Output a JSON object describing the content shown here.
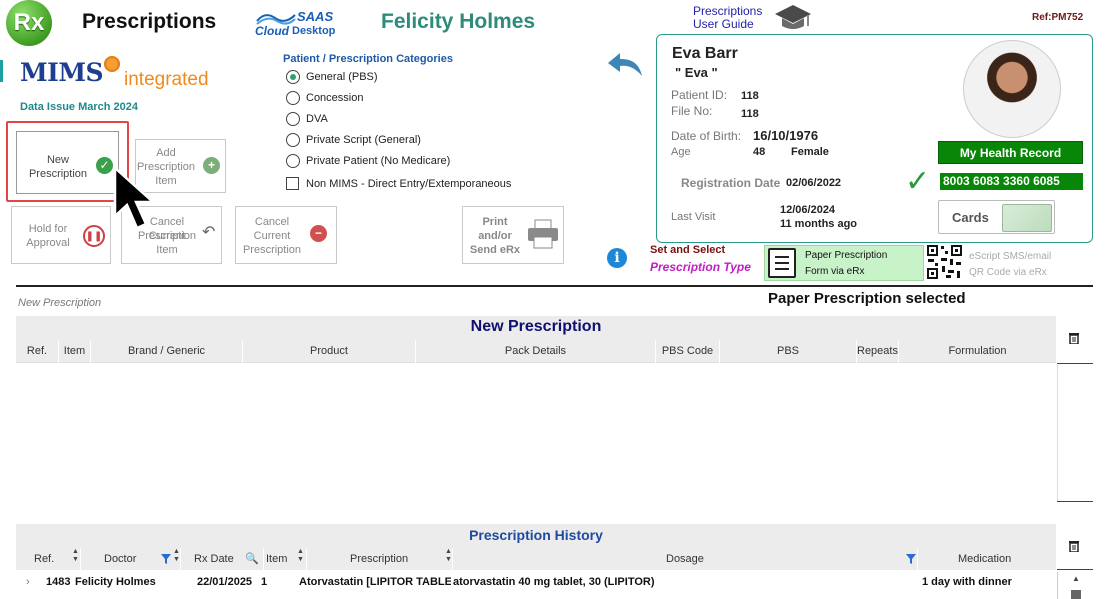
{
  "header": {
    "rx_logo": "Rx",
    "app_title": "Prescriptions",
    "saas_line1": "SAAS",
    "saas_line2": "Cloud",
    "saas_line3": "Desktop",
    "doctor_name": "Felicity Holmes",
    "user_guide_line1": "Prescriptions",
    "user_guide_line2": "User Guide",
    "ref_code": "Ref:PM752"
  },
  "mims": {
    "logo_text": "MIMS",
    "logo_suffix": "integrated",
    "data_issue": "Data Issue   March 2024"
  },
  "categories": {
    "title": "Patient / Prescription Categories",
    "options": [
      {
        "label": "General (PBS)",
        "selected": true
      },
      {
        "label": "Concession",
        "selected": false
      },
      {
        "label": "DVA",
        "selected": false
      },
      {
        "label": "Private Script (General)",
        "selected": false
      },
      {
        "label": "Private Patient (No Medicare)",
        "selected": false
      }
    ],
    "non_mims_label": "Non MIMS - Direct Entry/Extemporaneous"
  },
  "actions": {
    "new_rx": [
      "New",
      "Prescription"
    ],
    "add_item": [
      "Add",
      "Prescription",
      "Item"
    ],
    "hold": [
      "Hold for",
      "Approval"
    ],
    "cancel_item": [
      "Cancel Current",
      "Prescription",
      "Item"
    ],
    "cancel_rx": [
      "Cancel",
      "Current",
      "Prescription"
    ],
    "print": [
      "Print",
      "and/or",
      "Send eRx"
    ]
  },
  "patient": {
    "name": "Eva Barr",
    "preferred": "\" Eva \"",
    "patient_id_label": "Patient ID:",
    "patient_id": "118",
    "file_no_label": "File No:",
    "file_no": "118",
    "dob_label": "Date of Birth:",
    "dob": "16/10/1976",
    "age_label": "Age",
    "age": "48",
    "sex": "Female",
    "reg_label": "Registration Date",
    "reg_date": "02/06/2022",
    "last_visit_label": "Last Visit",
    "last_visit_date": "12/06/2024",
    "last_visit_ago": "11 months ago",
    "mhr_label": "My Health Record",
    "medicare_number": "8003 6083 3360 6085",
    "cards_label": "Cards"
  },
  "rx_type": {
    "set_select": "Set and Select",
    "rx_type_label": "Prescription Type",
    "paper_line1": "Paper Prescription",
    "paper_line2": "Form via eRx",
    "escript_line1": "eScript SMS/email",
    "escript_line2": "QR Code via eRx"
  },
  "status": {
    "new_rx_label": "New Prescription",
    "paper_selected": "Paper Prescription selected"
  },
  "new_rx_table": {
    "title": "New Prescription",
    "columns": [
      "Ref.",
      "Item",
      "Brand / Generic",
      "Product",
      "Pack Details",
      "PBS Code",
      "PBS",
      "Repeats",
      "Formulation"
    ]
  },
  "history": {
    "title": "Prescription History",
    "columns": [
      "Ref.",
      "Doctor",
      "Rx Date",
      "Item",
      "Prescription",
      "Dosage",
      "Medication"
    ],
    "rows": [
      {
        "ref": "1483",
        "doctor": "Felicity Holmes",
        "rx_date": "22/01/2025",
        "item": "1",
        "prescription": "Atorvastatin [LIPITOR TABLE",
        "dosage": "atorvastatin 40 mg tablet, 30 (LIPITOR)",
        "medication": "1 day with dinner"
      }
    ]
  },
  "colors": {
    "accent_teal": "#2e8b7a",
    "mhr_green": "#078607",
    "highlight_red": "#e04848",
    "paper_option_bg": "#c8f2c8"
  }
}
